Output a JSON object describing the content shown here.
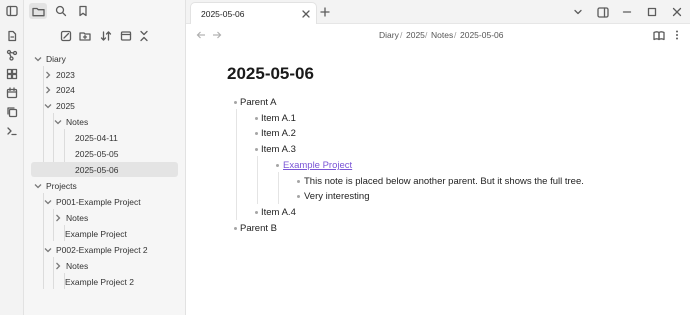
{
  "tab": {
    "title": "2025-05-06"
  },
  "breadcrumb": {
    "parts": [
      "Diary",
      "2025",
      "Notes",
      "2025-05-06"
    ]
  },
  "document": {
    "title": "2025-05-06",
    "items": {
      "parent_a": "Parent A",
      "item_a1": "Item A.1",
      "item_a2": "Item A.2",
      "item_a3": "Item A.3",
      "example_project": "Example Project",
      "note_text": "This note is placed below another parent. But it shows the full tree.",
      "very_interesting": "Very interesting",
      "item_a4": "Item A.4",
      "parent_b": "Parent B"
    }
  },
  "tree": {
    "diary": "Diary",
    "y2023": "2023",
    "y2024": "2024",
    "y2025": "2025",
    "notes": "Notes",
    "d1": "2025-04-11",
    "d2": "2025-05-05",
    "d3": "2025-05-06",
    "projects": "Projects",
    "p001": "P001-Example Project",
    "p001_notes": "Notes",
    "p001_file": "Example Project",
    "p002": "P002-Example Project 2",
    "p002_notes": "Notes",
    "p002_file": "Example Project 2"
  },
  "colors": {
    "link": "#7a55d6",
    "selected_row": "#e4e4e4"
  }
}
